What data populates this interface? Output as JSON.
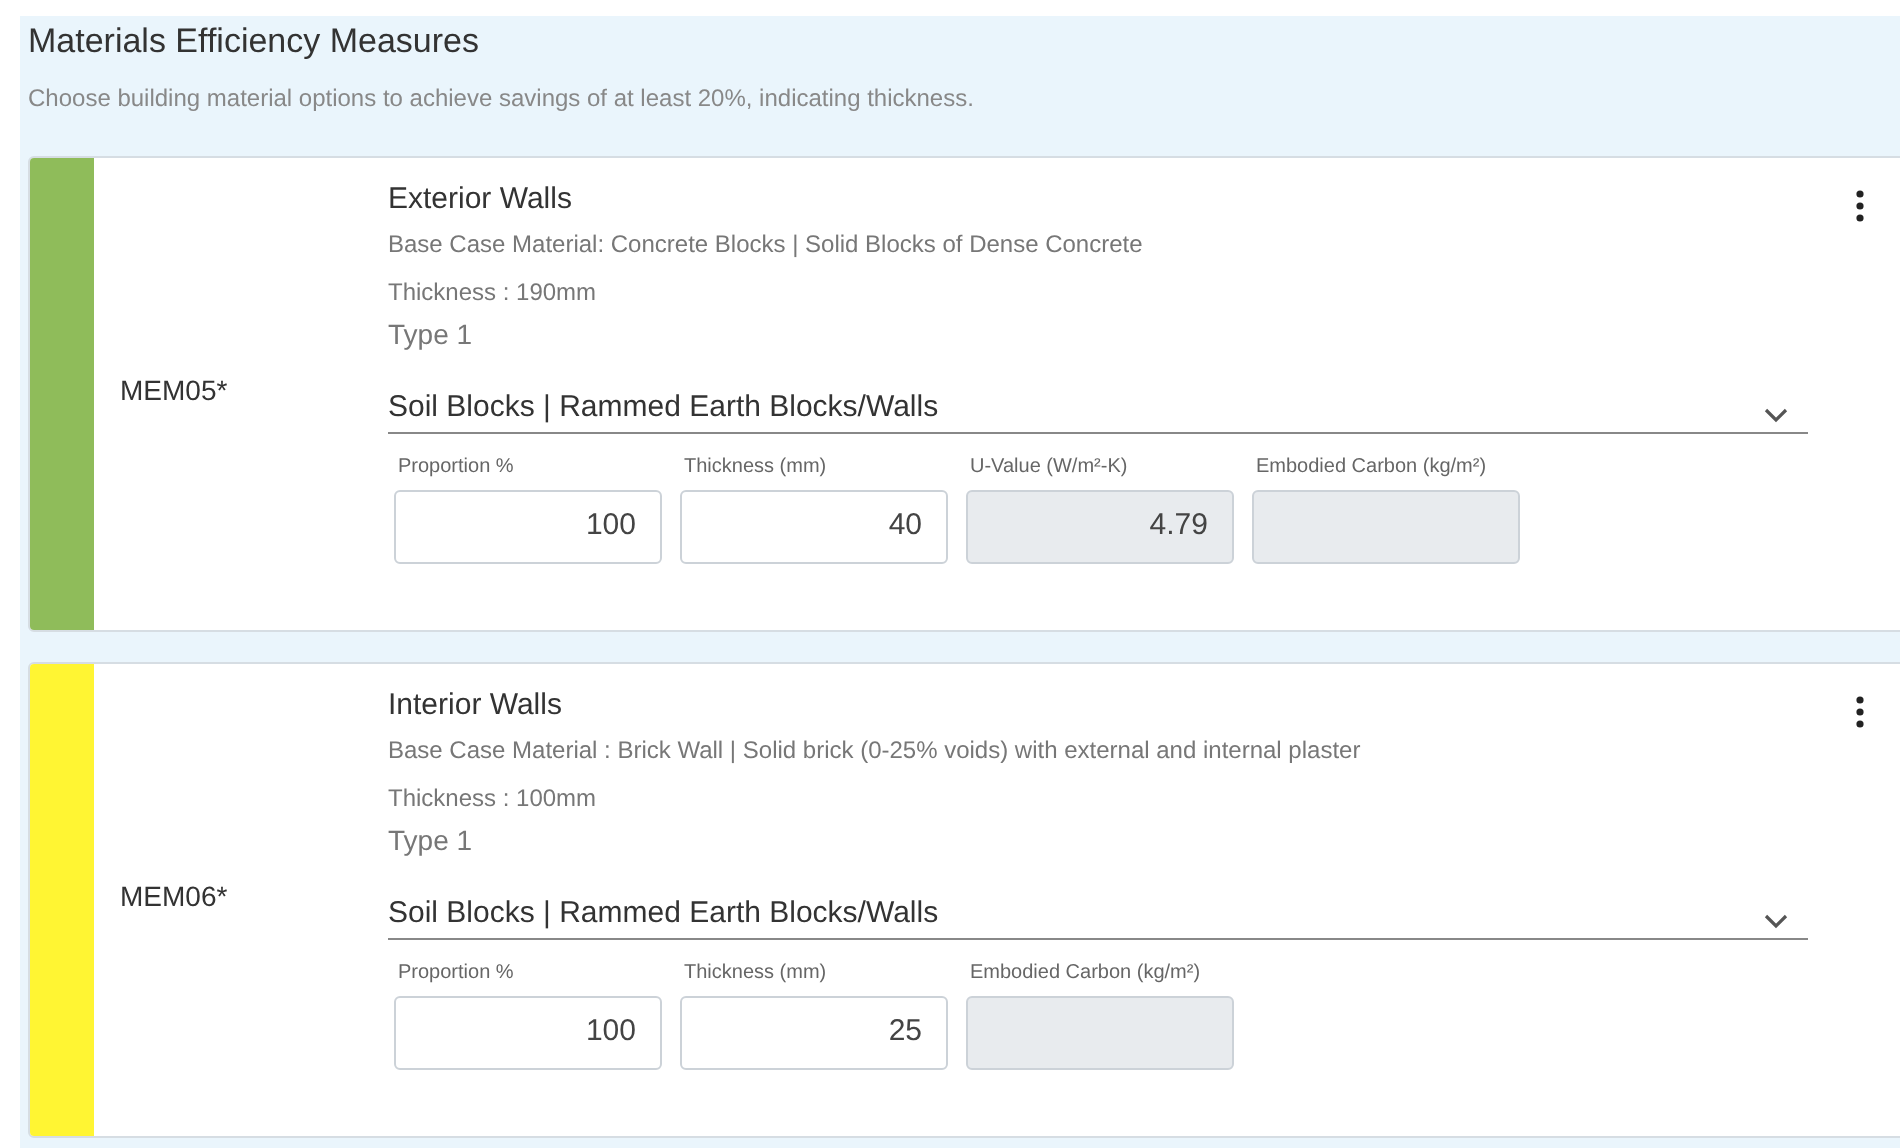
{
  "header": {
    "title": "Materials Efficiency Measures",
    "subtitle": "Choose building material options to achieve savings of at least 20%, indicating thickness."
  },
  "measures": [
    {
      "code": "MEM05*",
      "color": "#8fbc5a",
      "title": "Exterior Walls",
      "base_case": "Base Case Material: Concrete Blocks | Solid Blocks of Dense Concrete",
      "thickness": "Thickness : 190mm",
      "type": "Type 1",
      "selection": "Soil Blocks | Rammed Earth Blocks/Walls",
      "fields": [
        {
          "label": "Proportion %",
          "value": "100",
          "disabled": false
        },
        {
          "label": "Thickness (mm)",
          "value": "40",
          "disabled": false
        },
        {
          "label": "U-Value (W/m²-K)",
          "value": "4.79",
          "disabled": true
        },
        {
          "label": "Embodied Carbon (kg/m²)",
          "disabled": true
        }
      ]
    },
    {
      "code": "MEM06*",
      "color": "#fff533",
      "title": "Interior Walls",
      "base_case": "Base Case Material : Brick Wall | Solid brick (0-25% voids) with external and internal plaster",
      "thickness": "Thickness : 100mm",
      "type": "Type 1",
      "selection": "Soil Blocks | Rammed Earth Blocks/Walls",
      "fields": [
        {
          "label": "Proportion %",
          "value": "100",
          "disabled": false
        },
        {
          "label": "Thickness (mm)",
          "value": "25",
          "disabled": false
        },
        {
          "label": "Embodied Carbon (kg/m²)",
          "disabled": true
        }
      ]
    }
  ]
}
